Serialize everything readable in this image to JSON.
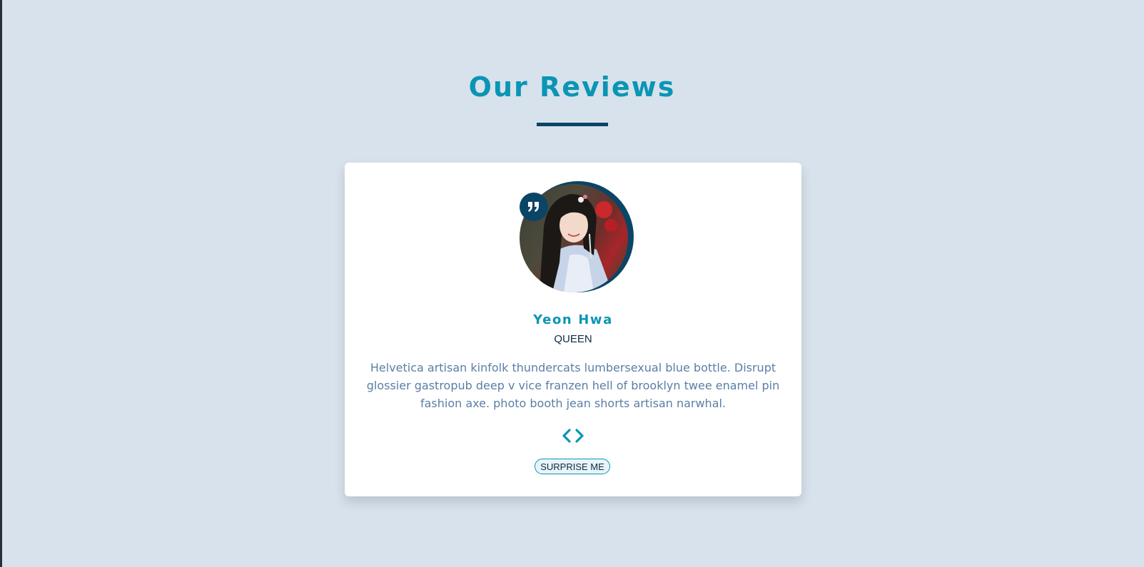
{
  "header": {
    "title": "Our Reviews"
  },
  "review": {
    "name": "Yeon Hwa",
    "job": "QUEEN",
    "text": "Helvetica artisan kinfolk thundercats lumbersexual blue bottle. Disrupt glossier gastropub deep v vice franzen hell of brooklyn twee enamel pin fashion axe. photo booth jean shorts artisan narwhal.",
    "quote_icon": "quote-right-icon",
    "avatar_alt": "Yeon Hwa"
  },
  "controls": {
    "prev_icon": "chevron-left-icon",
    "next_icon": "chevron-right-icon",
    "surprise_label": "SURPRISE ME"
  },
  "colors": {
    "background": "#d8e2ec",
    "accent": "#0b95b5",
    "dark": "#0a4566",
    "text": "#5a7ea6"
  }
}
